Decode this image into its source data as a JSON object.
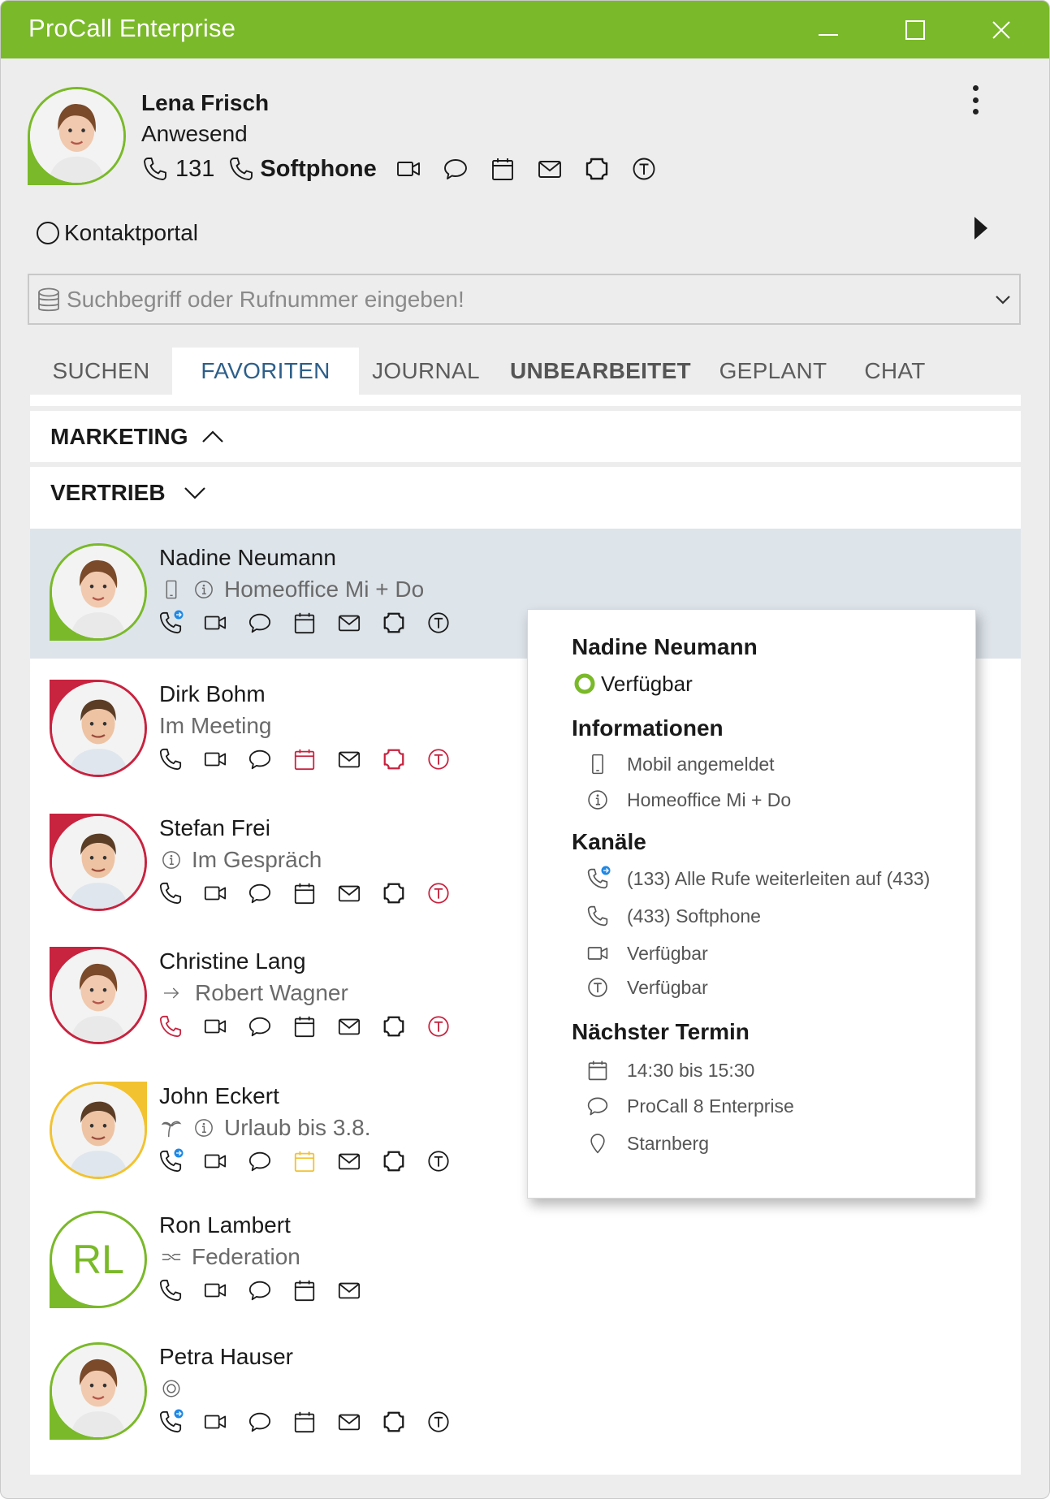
{
  "window": {
    "title": "ProCall Enterprise"
  },
  "me": {
    "name": "Lena Frisch",
    "status": "Anwesend",
    "phone_ext": "131",
    "softphone_label": "Softphone"
  },
  "portal": {
    "label": "Kontaktportal"
  },
  "search": {
    "placeholder": "Suchbegriff oder Rufnummer eingeben!"
  },
  "tabs": [
    {
      "label": "SUCHEN"
    },
    {
      "label": "FAVORITEN"
    },
    {
      "label": "JOURNAL"
    },
    {
      "label": "UNBEARBEITET"
    },
    {
      "label": "GEPLANT"
    },
    {
      "label": "CHAT"
    }
  ],
  "groups": [
    {
      "label": "MARKETING"
    },
    {
      "label": "VERTRIEB"
    }
  ],
  "contacts": [
    {
      "name": "Nadine Neumann",
      "status": "Homeoffice Mi + Do"
    },
    {
      "name": "Dirk Bohm",
      "status": "Im Meeting"
    },
    {
      "name": "Stefan Frei",
      "status": "Im Gespräch"
    },
    {
      "name": "Christine Lang",
      "status": "Robert Wagner"
    },
    {
      "name": "John Eckert",
      "status": "Urlaub bis 3.8."
    },
    {
      "name": "Ron Lambert",
      "status": "Federation",
      "initials": "RL"
    },
    {
      "name": "Petra Hauser",
      "status": ""
    }
  ],
  "card": {
    "name": "Nadine Neumann",
    "availability": "Verfügbar",
    "info_title": "Informationen",
    "info": [
      "Mobil angemeldet",
      "Homeoffice Mi + Do"
    ],
    "channels_title": "Kanäle",
    "channels": [
      "(133) Alle Rufe weiterleiten auf (433)",
      "(433) Softphone",
      "Verfügbar",
      "Verfügbar"
    ],
    "next_title": "Nächster Termin",
    "next": [
      "14:30 bis 15:30",
      "ProCall 8 Enterprise",
      "Starnberg"
    ]
  },
  "colors": {
    "titlebar": "#7ab929",
    "available": "#7ab929",
    "busy": "#c8233f",
    "away": "#f2c230",
    "tab_active_text": "#2d5f8a",
    "selected_row": "#dde4ea"
  },
  "icons": [
    "phone-icon",
    "phone-forward-icon",
    "video-icon",
    "chat-icon",
    "calendar-icon",
    "mail-icon",
    "screenshare-icon",
    "team-icon",
    "mobile-icon",
    "info-icon",
    "arrow-right-icon",
    "palm-icon",
    "federation-icon",
    "location-icon",
    "database-icon"
  ]
}
